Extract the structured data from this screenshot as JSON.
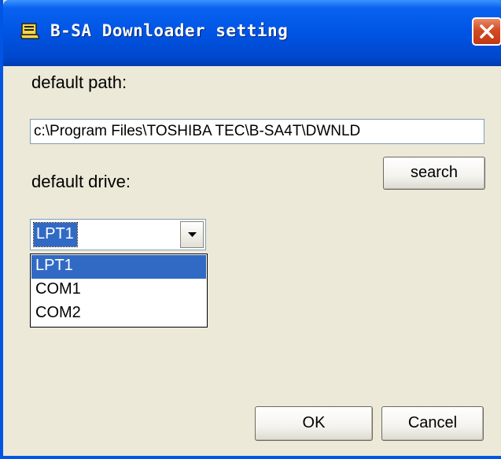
{
  "window": {
    "title": "B-SA Downloader setting"
  },
  "form": {
    "path_label": "default path:",
    "path_value": "c:\\Program Files\\TOSHIBA TEC\\B-SA4T\\DWNLD",
    "search_button": "search",
    "drive_label": "default drive:",
    "drive_selected": "LPT1",
    "drive_options": [
      "LPT1",
      "COM1",
      "COM2"
    ],
    "ok_button": "OK",
    "cancel_button": "Cancel"
  },
  "colors": {
    "titlebar": "#0054e3",
    "close": "#d24b23",
    "highlight": "#316ac5",
    "face": "#ece9d8"
  }
}
